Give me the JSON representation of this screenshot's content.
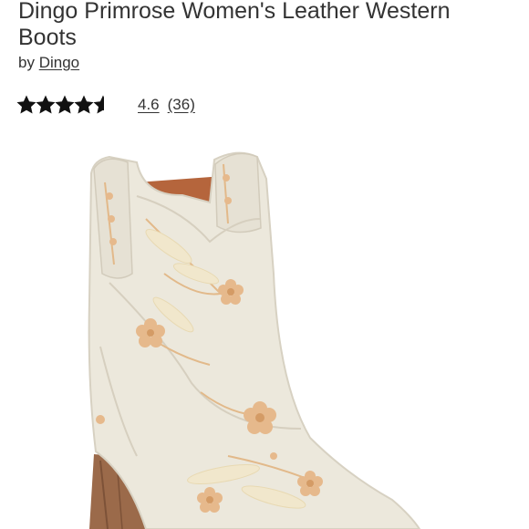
{
  "product": {
    "title": "Dingo Primrose Women's Leather Western Boots",
    "by_prefix": "by",
    "brand": "Dingo"
  },
  "rating": {
    "value": "4.6",
    "count": "(36)",
    "stars_filled": 4.6,
    "stars_total": 5,
    "star_color": "#111111"
  },
  "image": {
    "icon": "boot-product-image",
    "boot_color": "#ece8dc",
    "embroidery_color": "#e2b98a",
    "heel_color": "#9b6a4a",
    "lining_color": "#b5653c"
  }
}
